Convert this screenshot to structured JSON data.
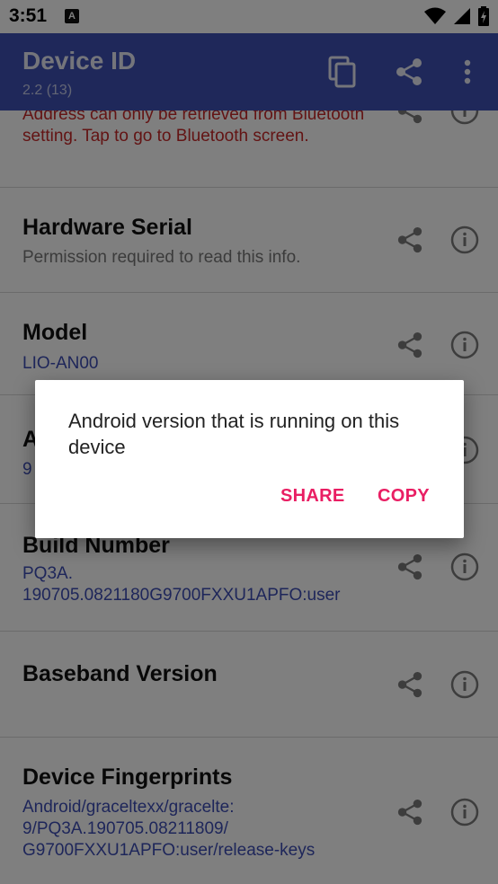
{
  "status_bar": {
    "time": "3:51",
    "notif_badge": "A"
  },
  "app_bar": {
    "title": "Device ID",
    "subtitle": "2.2 (13)"
  },
  "items": [
    {
      "title": "",
      "value": "Address can only be retrieved from Bluetooth setting. Tap to go to Bluetooth screen."
    },
    {
      "title": "Hardware Serial",
      "value": "Permission required to read this info."
    },
    {
      "title": "Model",
      "value": "LIO-AN00"
    },
    {
      "title": "A",
      "value": "9"
    },
    {
      "title": "Build Number",
      "value": "PQ3A.\n190705.0821180G9700FXXU1APFO:user"
    },
    {
      "title": "Baseband Version",
      "value": ""
    },
    {
      "title": "Device Fingerprints",
      "value": "Android/graceltexx/gracelte:\n9/PQ3A.190705.08211809/\nG9700FXXU1APFO:user/release-keys"
    }
  ],
  "dialog": {
    "message": "Android version that is running on this device",
    "share_label": "SHARE",
    "copy_label": "COPY"
  },
  "colors": {
    "app_bar": "#3f51b5",
    "accent": "#e91e63",
    "value_text": "#3d4db4",
    "error_text": "#c62828"
  }
}
